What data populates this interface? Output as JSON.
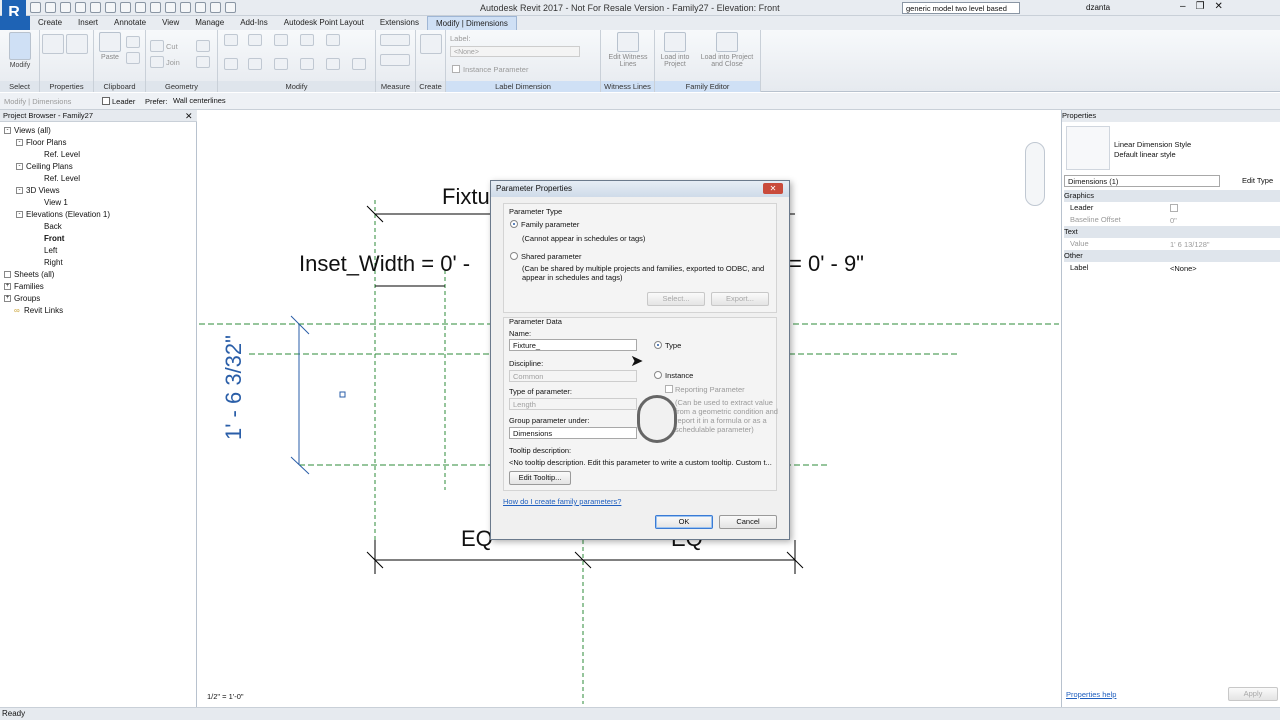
{
  "app": {
    "title": "Autodesk Revit 2017 - Not For Resale Version -    Family27 - Elevation: Front",
    "search": "generic model two level based",
    "user": "dzanta",
    "logo": "R"
  },
  "tabs": [
    "Create",
    "Insert",
    "Annotate",
    "View",
    "Manage",
    "Add-Ins",
    "Autodesk Point Layout",
    "Extensions",
    "Modify | Dimensions"
  ],
  "ribbon": {
    "panels": [
      "Select",
      "Properties",
      "Clipboard",
      "Geometry",
      "Modify",
      "Measure",
      "Create",
      "Label Dimension",
      "Witness Lines",
      "Family Editor"
    ],
    "modify": "Modify",
    "paste": "Paste",
    "cut": "Cut",
    "join": "Join",
    "label": "Label:",
    "label_value": "<None>",
    "instance_param": "Instance Parameter",
    "edit_witness": "Edit Witness Lines",
    "load_project": "Load into Project",
    "load_close": "Load into Project and Close"
  },
  "optbar": {
    "context": "Modify | Dimensions",
    "leader": "Leader",
    "prefer": "Prefer:",
    "prefer_value": "Wall centerlines"
  },
  "browser": {
    "title": "Project Browser - Family27",
    "tree": [
      "Views (all)",
      "Floor Plans",
      "Ref. Level",
      "Ceiling Plans",
      "Ref. Level",
      "3D Views",
      "View 1",
      "Elevations (Elevation 1)",
      "Back",
      "Front",
      "Left",
      "Right",
      "Sheets (all)",
      "Families",
      "Groups",
      "Revit Links"
    ]
  },
  "drawing": {
    "fixture": "Fixture_",
    "inset": "Inset_Width = 0' -",
    "right_dim": "= 0' - 9\"",
    "vertical": "1' - 6 3/32\"",
    "eq_left": "EQ",
    "eq_right": "EQ",
    "scale": "1/2\" = 1'-0\""
  },
  "props": {
    "title": "Properties",
    "type_name": "Linear Dimension Style",
    "type_sub": "Default linear style",
    "selector": "Dimensions (1)",
    "edit_type": "Edit Type",
    "sections": [
      "Graphics",
      "Text",
      "Other"
    ],
    "leader": "Leader",
    "baseline": "Baseline Offset",
    "baseline_val": "0\"",
    "value": "Value",
    "value_val": "1'  6 13/128\"",
    "label": "Label",
    "label_val": "<None>",
    "help": "Properties help",
    "apply": "Apply"
  },
  "status": "Ready",
  "dialog": {
    "title": "Parameter Properties",
    "param_type": "Parameter Type",
    "family": "Family parameter",
    "family_note": "(Cannot appear in schedules or tags)",
    "shared": "Shared parameter",
    "shared_note1": "(Can be shared by multiple projects and families, exported to ODBC, and",
    "shared_note2": "appear in schedules and tags)",
    "select": "Select...",
    "export": "Export...",
    "param_data": "Parameter Data",
    "name_label": "Name:",
    "name_value": "Fixture_",
    "discipline": "Discipline:",
    "discipline_value": "Common",
    "type_label": "Type of parameter:",
    "type_value": "Length",
    "group_label": "Group parameter under:",
    "group_value": "Dimensions",
    "type_radio": "Type",
    "instance_radio": "Instance",
    "reporting": "Reporting Parameter",
    "rep_note1": "(Can be used to extract value",
    "rep_note2": "from a geometric condition and",
    "rep_note3": "report it in a formula or as a",
    "rep_note4": "schedulable parameter)",
    "tooltip_label": "Tooltip description:",
    "tooltip_text": "<No tooltip description. Edit this parameter to write a custom tooltip. Custom t...",
    "edit_tooltip": "Edit Tooltip...",
    "how_link": "How do I create family parameters?",
    "ok": "OK",
    "cancel": "Cancel"
  }
}
